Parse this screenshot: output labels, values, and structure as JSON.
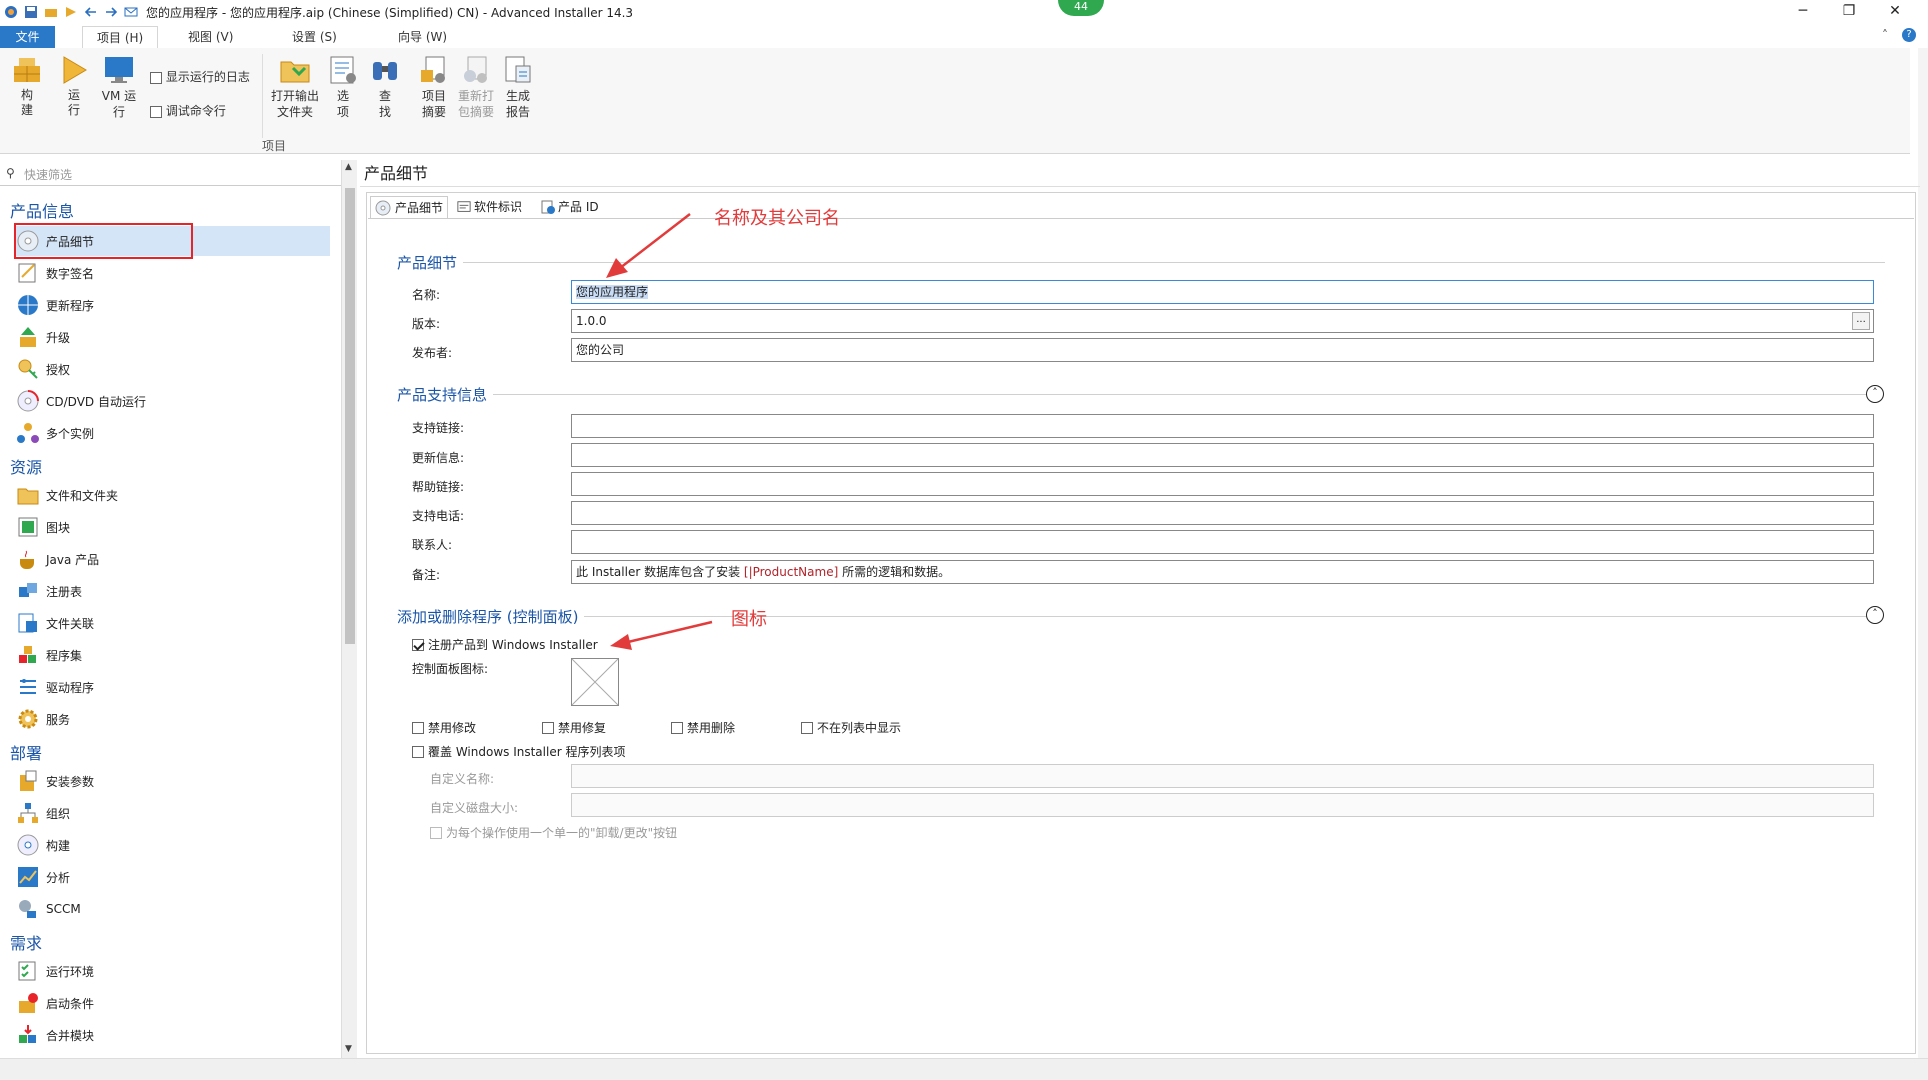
{
  "window": {
    "title": "您的应用程序 - 您的应用程序.aip (Chinese (Simplified) CN) - Advanced Installer 14.3",
    "badge": "44",
    "min": "─",
    "restore": "❐",
    "close": "✕"
  },
  "ribbon_tabs": [
    "文件",
    "项目 (H)",
    "视图 (V)",
    "设置 (S)",
    "向导 (W)"
  ],
  "ribbon": {
    "build": "构建",
    "build2": "建",
    "run": "运行",
    "run2": "行",
    "vm_run": "VM 运",
    "vm_run2": "行",
    "show_log": "显示运行的日志",
    "debug_cmd": "调试命令行",
    "open_output": "打开输出",
    "open_output2": "文件夹",
    "options": "选",
    "options2": "项",
    "find": "查",
    "find2": "找",
    "project_summary": "项目",
    "project_summary2": "摘要",
    "repack": "重新打",
    "repack2": "包摘要",
    "report": "生成",
    "report2": "报告",
    "group_label": "项目"
  },
  "left": {
    "filter_placeholder": "快速筛选",
    "cat_product": "产品信息",
    "cat_resources": "资源",
    "cat_deploy": "部署",
    "cat_req": "需求",
    "items_product": [
      "产品细节",
      "数字签名",
      "更新程序",
      "升级",
      "授权",
      "CD/DVD 自动运行",
      "多个实例"
    ],
    "items_resources": [
      "文件和文件夹",
      "图块",
      "Java 产品",
      "注册表",
      "文件关联",
      "程序集",
      "驱动程序",
      "服务"
    ],
    "items_deploy": [
      "安装参数",
      "组织",
      "构建",
      "分析",
      "SCCM"
    ],
    "items_req": [
      "运行环境",
      "启动条件",
      "合并模块"
    ]
  },
  "right": {
    "panel_title": "产品细节",
    "tabs": [
      "产品细节",
      "软件标识",
      "产品 ID"
    ],
    "sec_details": "产品细节",
    "name_label": "名称:",
    "name_value": "您的应用程序",
    "version_label": "版本:",
    "version_value": "1.0.0",
    "version_btn": "...",
    "publisher_label": "发布者:",
    "publisher_value": "您的公司",
    "sec_support": "产品支持信息",
    "support_link": "支持链接:",
    "update_info": "更新信息:",
    "help_link": "帮助链接:",
    "support_phone": "支持电话:",
    "contact": "联系人:",
    "comments": "备注:",
    "comments_value_a": "此 Installer 数据库包含了安装 ",
    "comments_value_b": "[|ProductName]",
    "comments_value_c": " 所需的逻辑和数据。",
    "sec_arp": "添加或删除程序 (控制面板)",
    "register_cb": "注册产品到 Windows Installer",
    "cp_icon": "控制面板图标:",
    "disable_modify": "禁用修改",
    "disable_repair": "禁用修复",
    "disable_remove": "禁用删除",
    "hide_in_list": "不在列表中显示",
    "override": "覆盖 Windows Installer 程序列表项",
    "custom_name": "自定义名称:",
    "custom_size": "自定义磁盘大小:",
    "single_button": "为每个操作使用一个单一的\"卸载/更改\"按钮"
  },
  "annotations": {
    "name_company": "名称及其公司名",
    "icon": "图标"
  }
}
